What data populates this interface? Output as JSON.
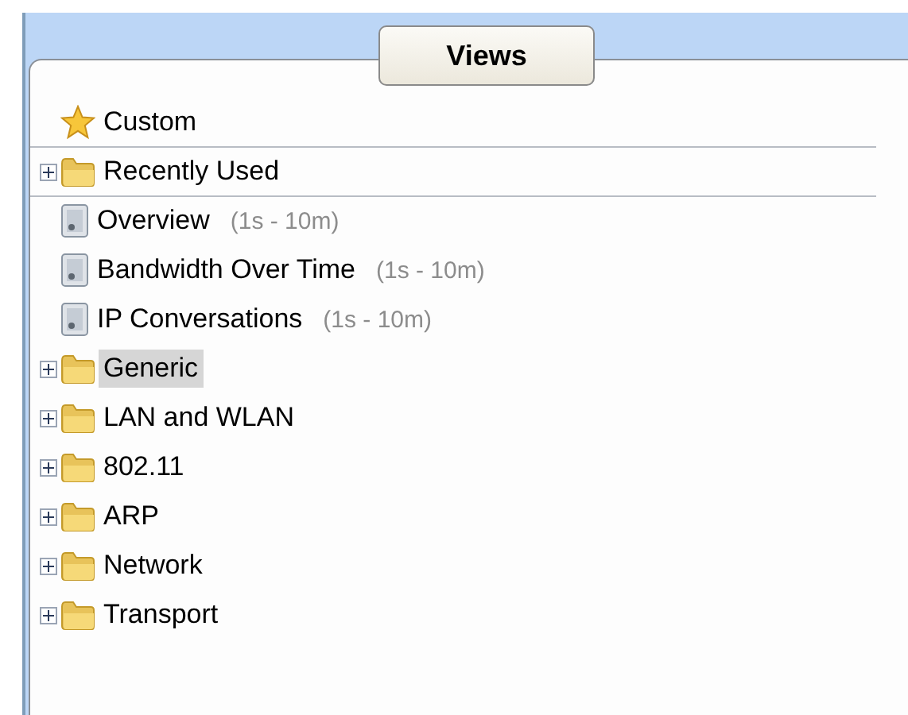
{
  "panel": {
    "title": "Views"
  },
  "items": [
    {
      "kind": "star",
      "label": "Custom",
      "selected": false,
      "divider_below": true
    },
    {
      "kind": "folder",
      "label": "Recently Used",
      "expanded": false,
      "selected": false,
      "divider_below": true
    },
    {
      "kind": "view",
      "label": "Overview",
      "range": "(1s - 10m)",
      "selected": false,
      "divider_below": false
    },
    {
      "kind": "view",
      "label": "Bandwidth Over Time",
      "range": "(1s - 10m)",
      "selected": false,
      "divider_below": false
    },
    {
      "kind": "view",
      "label": "IP Conversations",
      "range": "(1s - 10m)",
      "selected": false,
      "divider_below": false
    },
    {
      "kind": "folder",
      "label": "Generic",
      "expanded": false,
      "selected": true,
      "divider_below": false
    },
    {
      "kind": "folder",
      "label": "LAN and WLAN",
      "expanded": false,
      "selected": false,
      "divider_below": false
    },
    {
      "kind": "folder",
      "label": "802.11",
      "expanded": false,
      "selected": false,
      "divider_below": false
    },
    {
      "kind": "folder",
      "label": "ARP",
      "expanded": false,
      "selected": false,
      "divider_below": false
    },
    {
      "kind": "folder",
      "label": "Network",
      "expanded": false,
      "selected": false,
      "divider_below": false
    },
    {
      "kind": "folder",
      "label": "Transport",
      "expanded": false,
      "selected": false,
      "divider_below": false
    }
  ]
}
